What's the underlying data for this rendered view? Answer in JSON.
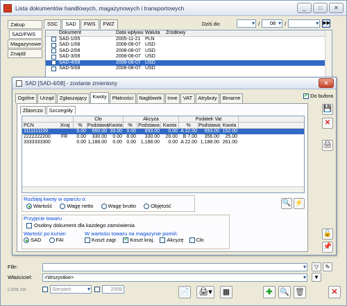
{
  "window": {
    "title": "Lista dokumentów handlowych, magazynowych i transportowych",
    "controls": [
      "_",
      "□",
      "✕"
    ]
  },
  "leftnav": [
    "Zakup",
    "SAD/FWS",
    "Magazynowe",
    "Znajdź"
  ],
  "list_tabs": [
    "SSC",
    "SAD",
    "FWS",
    "FWZ"
  ],
  "date_filter": {
    "label": "Dziś do:",
    "sep1": "/",
    "day": "08",
    "sep2": "/"
  },
  "list": {
    "headers": [
      "Dokument",
      "Data wpływu",
      "Waluta",
      "Źródłowy"
    ],
    "rows": [
      {
        "doc": "SAD-1/05",
        "date": "2005-11-21",
        "cur": "PLN"
      },
      {
        "doc": "SAD-1/08",
        "date": "2008-08-07",
        "cur": "USD"
      },
      {
        "doc": "SAD-2/08",
        "date": "2008-08-07",
        "cur": "USD"
      },
      {
        "doc": "SAD-3/08",
        "date": "2008-08-07",
        "cur": "USD"
      },
      {
        "doc": "SAD-4/08",
        "date": "2008-08-07",
        "cur": "USD"
      },
      {
        "doc": "SAD-5/08",
        "date": "2008-08-07",
        "cur": "USD"
      }
    ],
    "selected_index": 4
  },
  "dialog": {
    "title": "SAD [SAD-4/08] - zostanie zmieniony",
    "close": "✕",
    "tabs": [
      "Ogólne",
      "Urząd",
      "Zgłaszający",
      "Kwoty",
      "Płatności",
      "Nagłówek",
      "Inne",
      "VAT",
      "Atrybuty",
      "Binarne"
    ],
    "active_tab": "Kwoty",
    "do_bufora": "Do bufora",
    "subtabs": [
      "Zbiorczo",
      "Szczegóły"
    ],
    "grid": {
      "group_headers": [
        "Cło",
        "Akcyza",
        "Podatek Vat"
      ],
      "headers": [
        "PCN",
        "Kraj",
        "%",
        "Podstawa",
        "Kwota",
        "%",
        "Podstawa",
        "Kwota",
        "%",
        "Podstawa",
        "Kwota"
      ],
      "rows": [
        [
          "1111111100",
          "",
          "5.00",
          "660.00",
          "33.00",
          "0.00",
          "693.00",
          "0.00",
          "A 22.00",
          "693.00",
          "152.00"
        ],
        [
          "2222222200",
          "FR",
          "0.00",
          "330.00",
          "0.00",
          "8.00",
          "330.00",
          "26.00",
          "B 7.00",
          "356.00",
          "25.00"
        ],
        [
          "3333333300",
          "",
          "0.00",
          "1,188.00",
          "0.00",
          "0.00",
          "1,188.00",
          "0.00",
          "A 22.00",
          "1,188.00",
          "261.00"
        ]
      ]
    },
    "rozbijaj": {
      "title": "Rozbijaj kwoty w oparciu o:",
      "options": [
        "Wartość",
        "Wagę netto",
        "Wagę brutto",
        "Objętość"
      ]
    },
    "przyjecie": {
      "title": "Przyjęcie towaru",
      "osobny": "Osobny dokument dla każdego zamówienia"
    },
    "wartosc_kurs": {
      "title": "Wartość po kursie:",
      "options": [
        "SAD",
        "FAI"
      ]
    },
    "wartosc_towaru": {
      "title": "W wartości towaru na magazynie pomiń:",
      "items": [
        {
          "label": "Koszt zagr.",
          "checked": false
        },
        {
          "label": "Koszt kraj.",
          "checked": true
        },
        {
          "label": "Akcyzę",
          "checked": false
        },
        {
          "label": "Cło",
          "checked": false
        }
      ]
    }
  },
  "filters": {
    "filtr_label": "Filtr:",
    "wlasciciel_label": "Właściciel:",
    "wlasciciel_value": "<Wszystkie>",
    "lista_za_label": "Lista za:",
    "month": "Sierpień",
    "year": "2008"
  }
}
